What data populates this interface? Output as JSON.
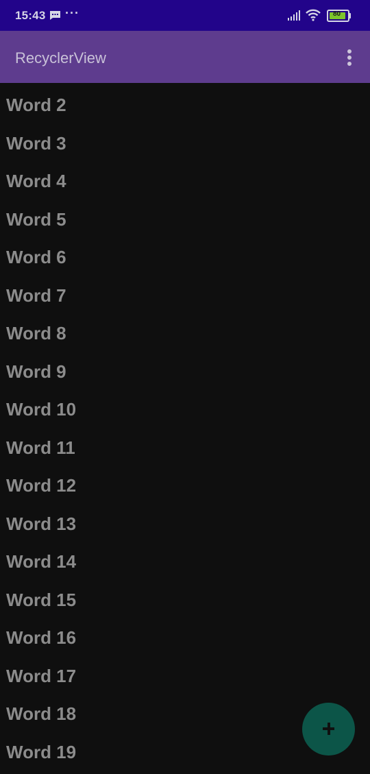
{
  "status_bar": {
    "time": "15:43",
    "notification_icons": [
      "message-icon",
      "more-dots-icon"
    ],
    "indicators": [
      "signal-icon",
      "wifi-icon",
      "battery-icon"
    ],
    "battery_level": "80",
    "background_color": "#22048a"
  },
  "app_bar": {
    "title": "RecyclerView",
    "menu_icon": "overflow-menu-icon",
    "background_color": "#5e3c8e"
  },
  "list": {
    "items": [
      "Word 2",
      "Word 3",
      "Word 4",
      "Word 5",
      "Word 6",
      "Word 7",
      "Word 8",
      "Word 9",
      "Word 10",
      "Word 11",
      "Word 12",
      "Word 13",
      "Word 14",
      "Word 15",
      "Word 16",
      "Word 17",
      "Word 18",
      "Word 19"
    ],
    "text_color": "#8c8c8c"
  },
  "fab": {
    "icon": "plus-icon",
    "color": "#0c5548"
  }
}
